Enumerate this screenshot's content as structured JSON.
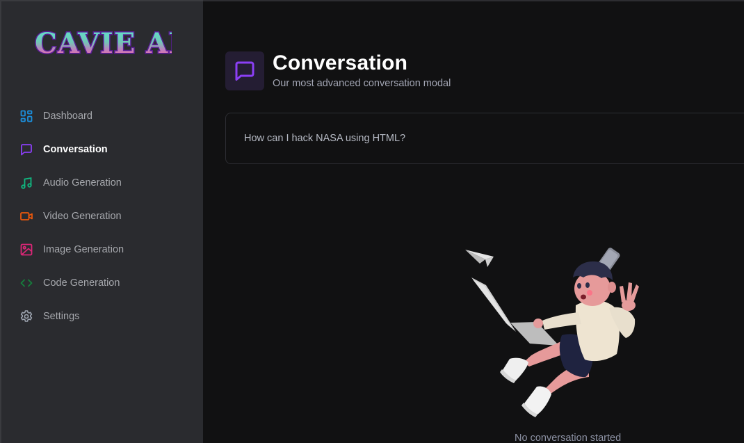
{
  "app": {
    "brand": "CAVIE AI"
  },
  "sidebar": {
    "items": [
      {
        "label": "Dashboard",
        "icon": "layout-grid-icon",
        "color": "#1b8fdc",
        "active": false
      },
      {
        "label": "Conversation",
        "icon": "chat-bubble-icon",
        "color": "#8b3ff6",
        "active": true
      },
      {
        "label": "Audio Generation",
        "icon": "music-note-icon",
        "color": "#10b981",
        "active": false
      },
      {
        "label": "Video Generation",
        "icon": "video-camera-icon",
        "color": "#ea580c",
        "active": false
      },
      {
        "label": "Image Generation",
        "icon": "image-icon",
        "color": "#db2777",
        "active": false
      },
      {
        "label": "Code Generation",
        "icon": "code-brackets-icon",
        "color": "#15803d",
        "active": false
      },
      {
        "label": "Settings",
        "icon": "gear-icon",
        "color": "#9ca3af",
        "active": false
      }
    ]
  },
  "header": {
    "title": "Conversation",
    "subtitle": "Our most advanced conversation modal",
    "icon": "chat-bubble-icon",
    "accent": "#8b3ff6"
  },
  "prompt": {
    "value": "How can I hack NASA using HTML?"
  },
  "empty_state": {
    "message": "No conversation started",
    "illustration": "falling-person-with-laptop-illustration"
  },
  "colors": {
    "sidebar_bg": "#2a2b2f",
    "main_bg": "#111112",
    "accent": "#8b3ff6"
  }
}
